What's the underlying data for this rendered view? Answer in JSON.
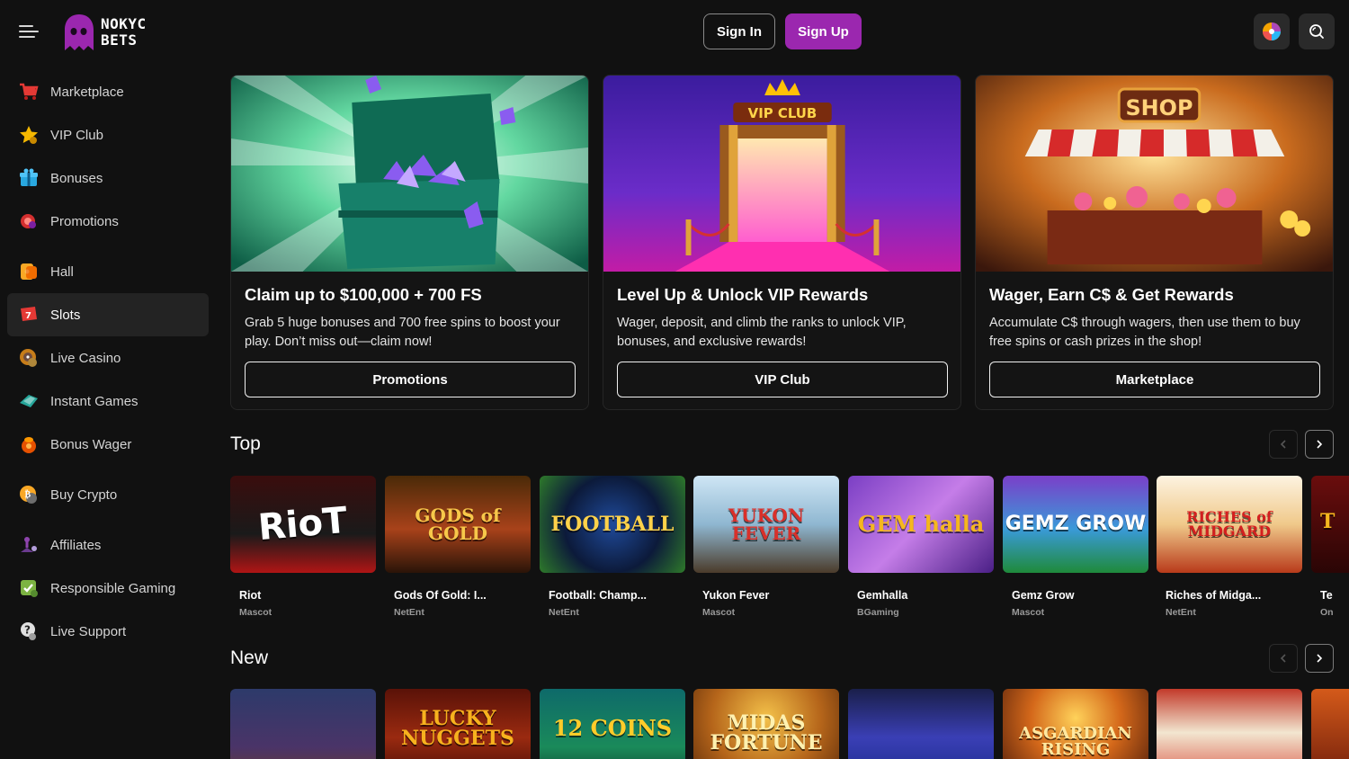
{
  "brand": {
    "line1": "NOKYC",
    "line2": "BETS"
  },
  "colors": {
    "accent": "#9b27af",
    "bg": "#111111",
    "active": "#232323"
  },
  "header": {
    "signin": "Sign In",
    "signup": "Sign Up"
  },
  "sidebar": {
    "items": [
      {
        "label": "Marketplace",
        "icon": "cart-icon"
      },
      {
        "label": "VIP Club",
        "icon": "star-icon"
      },
      {
        "label": "Bonuses",
        "icon": "gift-icon"
      },
      {
        "label": "Promotions",
        "icon": "promo-chip-icon"
      },
      {
        "label": "Hall",
        "icon": "hall-icon"
      },
      {
        "label": "Slots",
        "icon": "slots-icon",
        "active": true
      },
      {
        "label": "Live Casino",
        "icon": "roulette-icon"
      },
      {
        "label": "Instant Games",
        "icon": "instant-icon"
      },
      {
        "label": "Bonus Wager",
        "icon": "wager-icon"
      },
      {
        "label": "Buy Crypto",
        "icon": "coin-icon"
      },
      {
        "label": "Affiliates",
        "icon": "affiliates-icon"
      },
      {
        "label": "Responsible Gaming",
        "icon": "shield-check-icon"
      },
      {
        "label": "Live Support",
        "icon": "support-icon"
      }
    ]
  },
  "promos": [
    {
      "title": "Claim up to $100,000 + 700 FS",
      "desc": "Grab 5 huge bonuses and 700 free spins to boost your play. Don’t miss out—claim now!",
      "cta": "Promotions"
    },
    {
      "title": "Level Up & Unlock VIP Rewards",
      "desc": "Wager, deposit, and climb the ranks to unlock VIP, bonuses, and exclusive rewards!",
      "cta": "VIP Club",
      "banner": "VIP CLUB"
    },
    {
      "title": "Wager, Earn C$ & Get Rewards",
      "desc": "Accumulate C$ through wagers, then use them to buy free spins or cash prizes in the shop!",
      "cta": "Marketplace",
      "banner": "SHOP"
    }
  ],
  "sections": {
    "top": {
      "title": "Top",
      "games": [
        {
          "name": "Riot",
          "provider": "Mascot",
          "art": "RioT"
        },
        {
          "name": "Gods Of Gold: I...",
          "provider": "NetEnt",
          "art": "GODS of GOLD"
        },
        {
          "name": "Football: Champ...",
          "provider": "NetEnt",
          "art": "FOOTBALL"
        },
        {
          "name": "Yukon Fever",
          "provider": "Mascot",
          "art": "YUKON FEVER"
        },
        {
          "name": "Gemhalla",
          "provider": "BGaming",
          "art": "GEM halla"
        },
        {
          "name": "Gemz Grow",
          "provider": "Mascot",
          "art": "GEMZ GROW"
        },
        {
          "name": "Riches of Midga...",
          "provider": "NetEnt",
          "art": "RICHES of MIDGARD"
        },
        {
          "name": "Te",
          "provider": "On",
          "art": "T"
        }
      ]
    },
    "new": {
      "title": "New",
      "games": [
        {
          "art": ""
        },
        {
          "art": "LUCKY NUGGETS"
        },
        {
          "art": "12 COINS"
        },
        {
          "art": "MIDAS FORTUNE"
        },
        {
          "art": ""
        },
        {
          "art": "ASGARDIAN RISING"
        },
        {
          "art": ""
        },
        {
          "art": ""
        }
      ]
    }
  }
}
